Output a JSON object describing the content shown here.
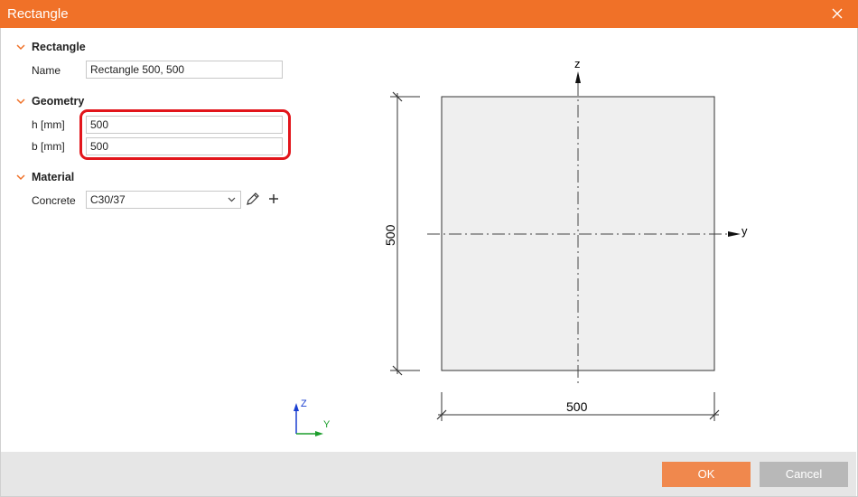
{
  "window": {
    "title": "Rectangle"
  },
  "sections": {
    "rectangle": {
      "title": "Rectangle",
      "name_label": "Name",
      "name_value": "Rectangle 500, 500"
    },
    "geometry": {
      "title": "Geometry",
      "h_label": "h [mm]",
      "h_value": "500",
      "b_label": "b [mm]",
      "b_value": "500"
    },
    "material": {
      "title": "Material",
      "concrete_label": "Concrete",
      "concrete_value": "C30/37"
    }
  },
  "drawing": {
    "z_axis_label": "z",
    "y_axis_label": "y",
    "height_dim": "500",
    "width_dim": "500",
    "global_axis_z": "Z",
    "global_axis_y": "Y"
  },
  "buttons": {
    "ok": "OK",
    "cancel": "Cancel"
  },
  "colors": {
    "accent": "#f07128",
    "highlight": "#e2151b",
    "axis_blue": "#1a3fd1",
    "axis_green": "#1c9e2c"
  }
}
